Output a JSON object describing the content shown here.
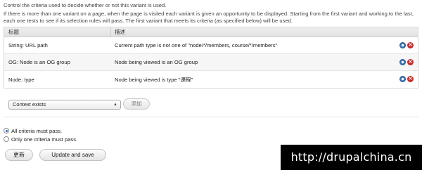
{
  "intro": {
    "line1": "Control the criteria used to decide whether or not this variant is used.",
    "line2": "If there is more than one variant on a page, when the page is visited each variant is given an opportunity to be displayed. Starting from the first variant and working to the last, each one tests to see if its selection rules will pass. The first variant that meets its criteria (as specified below) will be used."
  },
  "table": {
    "headers": [
      "标题",
      "描述"
    ],
    "rows": [
      {
        "title": "String: URL path",
        "description": "Current path type is not one of \"node/*/members, course/*/members\""
      },
      {
        "title": "OG: Node is an OG group",
        "description": "Node being viewed is an OG group"
      },
      {
        "title": "Node: type",
        "description": "Node being viewed is type \"课程\""
      }
    ],
    "icons": [
      "gear-icon",
      "delete-icon"
    ]
  },
  "add": {
    "select_value": "Context exists",
    "add_label": "添加"
  },
  "criteria": {
    "options": [
      "All criteria must pass.",
      "Only one criteria must pass."
    ],
    "selected_index": 0
  },
  "buttons": {
    "update": "更新",
    "update_and_save": "Update and save"
  },
  "watermark": "http://drupalchina.cn",
  "colors": {
    "accent": "#1f6fd0",
    "delete": "#c92b2b",
    "gear": "#3b77b6",
    "watermark_bg": "#000000"
  }
}
